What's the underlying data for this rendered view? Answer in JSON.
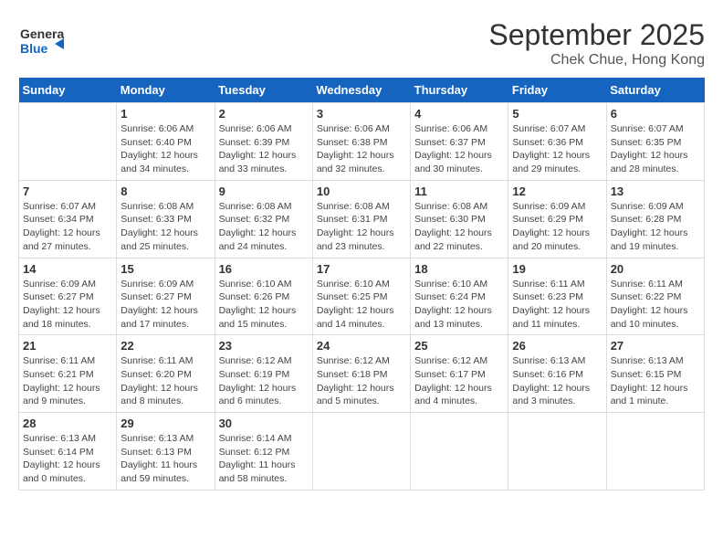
{
  "header": {
    "logo_general": "General",
    "logo_blue": "Blue",
    "title": "September 2025",
    "location": "Chek Chue, Hong Kong"
  },
  "days_of_week": [
    "Sunday",
    "Monday",
    "Tuesday",
    "Wednesday",
    "Thursday",
    "Friday",
    "Saturday"
  ],
  "weeks": [
    [
      {
        "day": "",
        "info": ""
      },
      {
        "day": "1",
        "info": "Sunrise: 6:06 AM\nSunset: 6:40 PM\nDaylight: 12 hours\nand 34 minutes."
      },
      {
        "day": "2",
        "info": "Sunrise: 6:06 AM\nSunset: 6:39 PM\nDaylight: 12 hours\nand 33 minutes."
      },
      {
        "day": "3",
        "info": "Sunrise: 6:06 AM\nSunset: 6:38 PM\nDaylight: 12 hours\nand 32 minutes."
      },
      {
        "day": "4",
        "info": "Sunrise: 6:06 AM\nSunset: 6:37 PM\nDaylight: 12 hours\nand 30 minutes."
      },
      {
        "day": "5",
        "info": "Sunrise: 6:07 AM\nSunset: 6:36 PM\nDaylight: 12 hours\nand 29 minutes."
      },
      {
        "day": "6",
        "info": "Sunrise: 6:07 AM\nSunset: 6:35 PM\nDaylight: 12 hours\nand 28 minutes."
      }
    ],
    [
      {
        "day": "7",
        "info": "Sunrise: 6:07 AM\nSunset: 6:34 PM\nDaylight: 12 hours\nand 27 minutes."
      },
      {
        "day": "8",
        "info": "Sunrise: 6:08 AM\nSunset: 6:33 PM\nDaylight: 12 hours\nand 25 minutes."
      },
      {
        "day": "9",
        "info": "Sunrise: 6:08 AM\nSunset: 6:32 PM\nDaylight: 12 hours\nand 24 minutes."
      },
      {
        "day": "10",
        "info": "Sunrise: 6:08 AM\nSunset: 6:31 PM\nDaylight: 12 hours\nand 23 minutes."
      },
      {
        "day": "11",
        "info": "Sunrise: 6:08 AM\nSunset: 6:30 PM\nDaylight: 12 hours\nand 22 minutes."
      },
      {
        "day": "12",
        "info": "Sunrise: 6:09 AM\nSunset: 6:29 PM\nDaylight: 12 hours\nand 20 minutes."
      },
      {
        "day": "13",
        "info": "Sunrise: 6:09 AM\nSunset: 6:28 PM\nDaylight: 12 hours\nand 19 minutes."
      }
    ],
    [
      {
        "day": "14",
        "info": "Sunrise: 6:09 AM\nSunset: 6:27 PM\nDaylight: 12 hours\nand 18 minutes."
      },
      {
        "day": "15",
        "info": "Sunrise: 6:09 AM\nSunset: 6:27 PM\nDaylight: 12 hours\nand 17 minutes."
      },
      {
        "day": "16",
        "info": "Sunrise: 6:10 AM\nSunset: 6:26 PM\nDaylight: 12 hours\nand 15 minutes."
      },
      {
        "day": "17",
        "info": "Sunrise: 6:10 AM\nSunset: 6:25 PM\nDaylight: 12 hours\nand 14 minutes."
      },
      {
        "day": "18",
        "info": "Sunrise: 6:10 AM\nSunset: 6:24 PM\nDaylight: 12 hours\nand 13 minutes."
      },
      {
        "day": "19",
        "info": "Sunrise: 6:11 AM\nSunset: 6:23 PM\nDaylight: 12 hours\nand 11 minutes."
      },
      {
        "day": "20",
        "info": "Sunrise: 6:11 AM\nSunset: 6:22 PM\nDaylight: 12 hours\nand 10 minutes."
      }
    ],
    [
      {
        "day": "21",
        "info": "Sunrise: 6:11 AM\nSunset: 6:21 PM\nDaylight: 12 hours\nand 9 minutes."
      },
      {
        "day": "22",
        "info": "Sunrise: 6:11 AM\nSunset: 6:20 PM\nDaylight: 12 hours\nand 8 minutes."
      },
      {
        "day": "23",
        "info": "Sunrise: 6:12 AM\nSunset: 6:19 PM\nDaylight: 12 hours\nand 6 minutes."
      },
      {
        "day": "24",
        "info": "Sunrise: 6:12 AM\nSunset: 6:18 PM\nDaylight: 12 hours\nand 5 minutes."
      },
      {
        "day": "25",
        "info": "Sunrise: 6:12 AM\nSunset: 6:17 PM\nDaylight: 12 hours\nand 4 minutes."
      },
      {
        "day": "26",
        "info": "Sunrise: 6:13 AM\nSunset: 6:16 PM\nDaylight: 12 hours\nand 3 minutes."
      },
      {
        "day": "27",
        "info": "Sunrise: 6:13 AM\nSunset: 6:15 PM\nDaylight: 12 hours\nand 1 minute."
      }
    ],
    [
      {
        "day": "28",
        "info": "Sunrise: 6:13 AM\nSunset: 6:14 PM\nDaylight: 12 hours\nand 0 minutes."
      },
      {
        "day": "29",
        "info": "Sunrise: 6:13 AM\nSunset: 6:13 PM\nDaylight: 11 hours\nand 59 minutes."
      },
      {
        "day": "30",
        "info": "Sunrise: 6:14 AM\nSunset: 6:12 PM\nDaylight: 11 hours\nand 58 minutes."
      },
      {
        "day": "",
        "info": ""
      },
      {
        "day": "",
        "info": ""
      },
      {
        "day": "",
        "info": ""
      },
      {
        "day": "",
        "info": ""
      }
    ]
  ]
}
